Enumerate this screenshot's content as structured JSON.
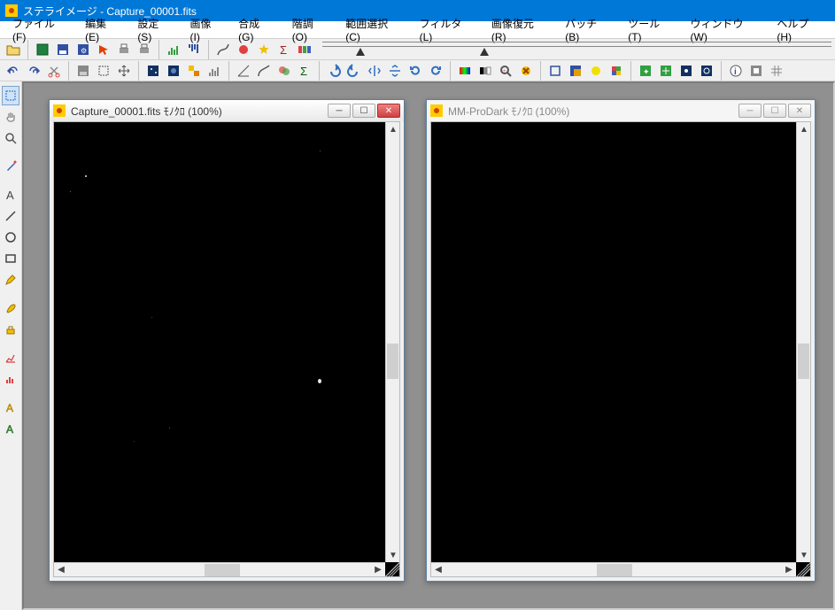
{
  "app": {
    "name": "ステライメージ",
    "title": "ステライメージ  - Capture_00001.fits"
  },
  "menu": {
    "file": "ファイル(F)",
    "edit": "編集(E)",
    "settings": "設定(S)",
    "image": "画像(I)",
    "compose": "合成(G)",
    "gradation": "階調(O)",
    "range": "範囲選択(C)",
    "filter": "フィルタ(L)",
    "restore": "画像復元(R)",
    "batch": "バッチ(B)",
    "tool": "ツール(T)",
    "window": "ウィンドウ(W)",
    "help": "ヘルプ(H)"
  },
  "icons": {
    "open": "open",
    "new": "new",
    "save": "save",
    "save2": "save-settings",
    "print": "print",
    "print2": "print-preview",
    "hist": "histogram",
    "hist2": "histogram-flip",
    "graph": "level-curve",
    "redstar": "color-adjust",
    "star": "star",
    "sigma": "sigma",
    "rb": "rgb-separate",
    "undo": "undo",
    "redo": "redo",
    "cut": "cut",
    "square": "select-rect",
    "move": "move-tool",
    "comp1": "composite-1",
    "comp2": "composite-2",
    "mosaic": "mosaic",
    "hist3": "tone-curve",
    "hist4": "levels",
    "hist5": "auto-level",
    "hsv": "color-balance",
    "sig2": "sigma-clip",
    "arrow-l": "rotate-left",
    "arrow-r": "rotate-right",
    "arrow-u": "flip",
    "arrow-d": "flip-v",
    "map1": "gradient",
    "map2": "false-color",
    "mag": "sharpen",
    "x": "cancel-op",
    "sq1": "crop",
    "sq2": "channel",
    "yel": "highlight",
    "pal": "palette",
    "a1": "measure",
    "a2": "astrometry",
    "a3": "blink",
    "a4": "photometry",
    "info": "image-info",
    "m1": "mask",
    "m2": "grid"
  },
  "side": {
    "sel": "select-tool",
    "drag": "hand-tool",
    "zoom": "zoom-tool",
    "dropper": "eyedropper",
    "text": "text-tool",
    "line": "line-tool",
    "circle": "circle-tool",
    "rect": "rect-tool",
    "pen": "pen-tool",
    "brush": "brush-tool",
    "color": "color-tool",
    "graph": "graph-tool",
    "hist": "histogram-tool",
    "text2": "annotation",
    "textA": "label-tool"
  },
  "windows": {
    "left": {
      "title": "Capture_00001.fits ﾓﾉｸﾛ (100%)",
      "active": true
    },
    "right": {
      "title": "MM-ProDark ﾓﾉｸﾛ (100%)",
      "active": false
    }
  },
  "colors": {
    "title_bg": "#0078d7",
    "workspace": "#909090"
  }
}
